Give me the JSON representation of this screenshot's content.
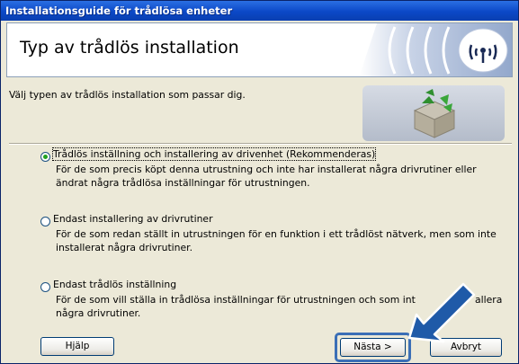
{
  "window": {
    "title": "Installationsguide för trådlösa enheter"
  },
  "header": {
    "title": "Typ av trådlös installation"
  },
  "subtitle": "Välj typen av trådlös installation som passar dig.",
  "options": [
    {
      "label": "Trådlös inställning och installering av drivenhet  (Rekommenderas)",
      "description": "För de som precis köpt denna utrustning och inte har installerat några drivrutiner eller ändrat några trådlösa inställningar för utrustningen.",
      "selected": true
    },
    {
      "label": "Endast installering av drivrutiner",
      "description": "För de som redan ställt in utrustningen för en funktion i ett trådlöst nätverk, men som inte installerat några drivrutiner.",
      "selected": false
    },
    {
      "label": "Endast trådlös inställning",
      "description_line1": "För de som vill ställa in trådlösa inställningar för utrustningen och som int",
      "description_line1_tail": "allera",
      "description_line2": "några drivrutiner.",
      "selected": false
    }
  ],
  "buttons": {
    "help": "Hjälp",
    "next": "Nästa >",
    "cancel": "Avbryt"
  },
  "colors": {
    "titlebar": "#0b48c7",
    "dialog_bg": "#ece9d8",
    "arrow": "#1f5aa8",
    "highlight": "#3b6fb6"
  },
  "icons": {
    "logo": "wireless-signal-icon",
    "graphic": "package-box-icon",
    "arrow": "pointer-arrow-icon"
  }
}
